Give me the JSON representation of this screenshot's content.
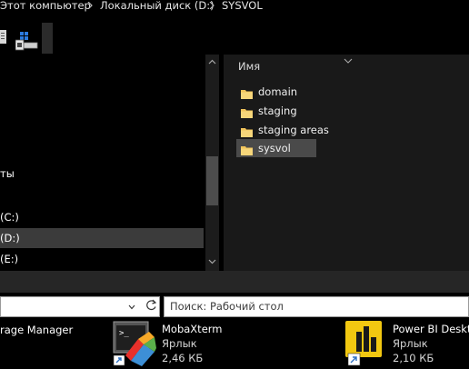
{
  "breadcrumb": {
    "items": [
      "Этот компьютер",
      "Локальный диск (D:)",
      "SYSVOL"
    ]
  },
  "nav": {
    "items": [
      {
        "label": "ты",
        "selected": false
      },
      {
        "label": "(C:)",
        "selected": false
      },
      {
        "label": "(D:)",
        "selected": true
      },
      {
        "label": "(E:)",
        "selected": false
      }
    ]
  },
  "filelist": {
    "column_name": "Имя",
    "items": [
      {
        "name": "domain",
        "selected": false
      },
      {
        "name": "staging",
        "selected": false
      },
      {
        "name": "staging areas",
        "selected": false
      },
      {
        "name": "sysvol",
        "selected": true
      }
    ]
  },
  "search": {
    "placeholder": "Поиск: Рабочий стол"
  },
  "desktop": {
    "items": [
      {
        "title": "rage Manager",
        "type": "",
        "size": ""
      },
      {
        "title": "MobaXterm",
        "type": "Ярлык",
        "size": "2,46 КБ",
        "icon": "mobaxterm-icon"
      },
      {
        "title": "Power BI Deskto",
        "type": "Ярлык",
        "size": "2,10 КБ",
        "icon": "power-bi-icon"
      }
    ]
  },
  "colors": {
    "folder": "#f2c55c",
    "powerbi": "#f2c811",
    "selected_row": "#4a4a4a",
    "pane_bg": "#191919"
  }
}
